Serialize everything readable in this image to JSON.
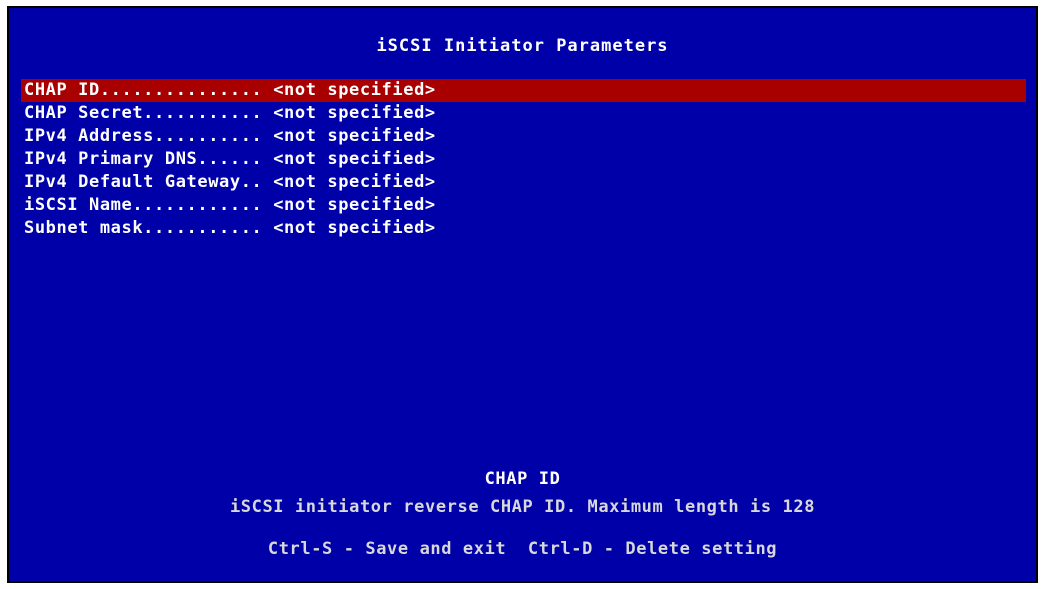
{
  "screen": {
    "title": "iSCSI Initiator Parameters",
    "colors": {
      "background": "#0000a8",
      "selection": "#a80000",
      "text": "#ffffff"
    }
  },
  "parameters": [
    {
      "name": "CHAP ID...............",
      "value": " <not specified>",
      "selected": true
    },
    {
      "name": "CHAP Secret...........",
      "value": " <not specified>",
      "selected": false
    },
    {
      "name": "IPv4 Address..........",
      "value": " <not specified>",
      "selected": false
    },
    {
      "name": "IPv4 Primary DNS......",
      "value": " <not specified>",
      "selected": false
    },
    {
      "name": "IPv4 Default Gateway..",
      "value": " <not specified>",
      "selected": false
    },
    {
      "name": "iSCSI Name............",
      "value": " <not specified>",
      "selected": false
    },
    {
      "name": "Subnet mask...........",
      "value": " <not specified>",
      "selected": false
    }
  ],
  "help": {
    "title": "CHAP ID",
    "description": "iSCSI initiator reverse CHAP ID. Maximum length is 128",
    "keys": "Ctrl-S - Save and exit  Ctrl-D - Delete setting"
  }
}
